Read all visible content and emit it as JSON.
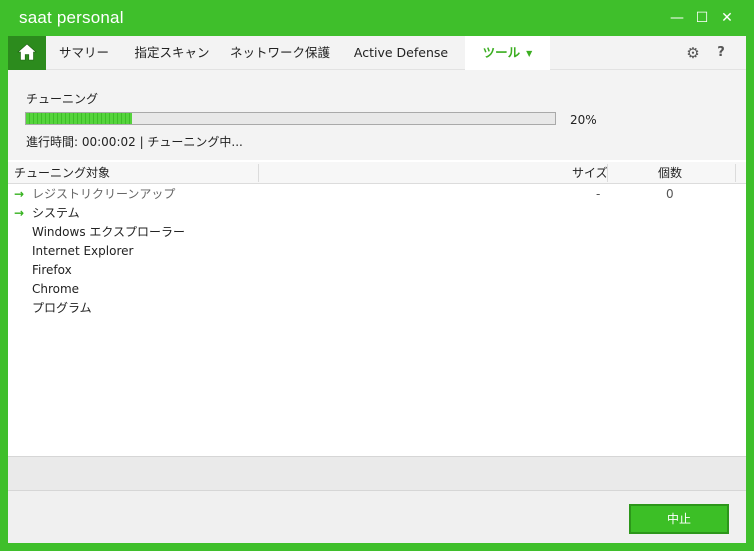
{
  "app": {
    "title": "saat personal"
  },
  "window_controls": {
    "minimize": "—",
    "maximize": "☐",
    "close": "✕"
  },
  "nav": {
    "tabs": [
      {
        "label": "サマリー"
      },
      {
        "label": "指定スキャン"
      },
      {
        "label": "ネットワーク保護"
      },
      {
        "label": "Active Defense"
      },
      {
        "label": "ツール",
        "active": true
      }
    ],
    "settings_glyph": "⚙",
    "help_glyph": "?"
  },
  "progress": {
    "title": "チューニング",
    "percent_value": 20,
    "percent_label": "20%",
    "status": "進行時間: 00:00:02 | チューニング中..."
  },
  "table": {
    "headers": {
      "target": "チューニング対象",
      "size": "サイズ",
      "count": "個数"
    },
    "rows": [
      {
        "label": "レジストリクリーンアップ",
        "arrow": true,
        "size": "-",
        "count": "0",
        "muted": true
      },
      {
        "label": "システム",
        "arrow": true,
        "size": "",
        "count": ""
      },
      {
        "label": "Windows エクスプローラー",
        "arrow": false,
        "size": "",
        "count": ""
      },
      {
        "label": "Internet Explorer",
        "arrow": false,
        "size": "",
        "count": ""
      },
      {
        "label": "Firefox",
        "arrow": false,
        "size": "",
        "count": ""
      },
      {
        "label": "Chrome",
        "arrow": false,
        "size": "",
        "count": ""
      },
      {
        "label": "プログラム",
        "arrow": false,
        "size": "",
        "count": ""
      }
    ]
  },
  "footer": {
    "stop_label": "中止"
  },
  "colors": {
    "brand": "#3fbf2b",
    "accent": "#3cae22",
    "home": "#2c8b1d"
  }
}
